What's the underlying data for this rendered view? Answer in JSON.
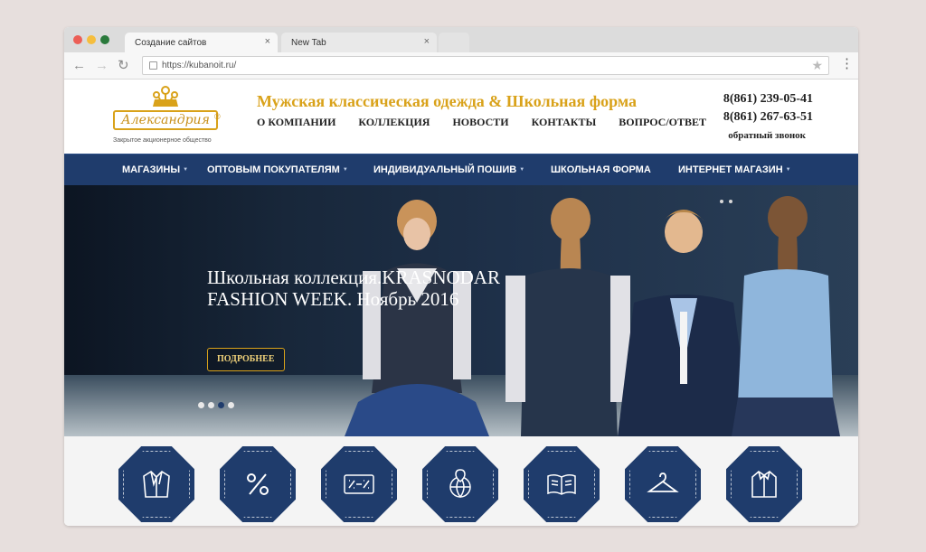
{
  "browser": {
    "tabs": [
      {
        "label": "Создание сайтов",
        "close": "×"
      },
      {
        "label": "New Tab",
        "close": "×"
      }
    ],
    "url": "https://kubanoit.ru/",
    "icons": [
      "back-arrow-icon",
      "forward-arrow-icon",
      "reload-icon",
      "lock-icon",
      "star-icon",
      "menu-dots-icon"
    ]
  },
  "header": {
    "logo_name": "Александрия",
    "logo_reg": "®",
    "logo_subtitle": "Закрытое акционерное общество",
    "slogan": "Мужская классическая одежда & Школьная форма",
    "top_nav": [
      "О КОМПАНИИ",
      "КОЛЛЕКЦИЯ",
      "НОВОСТИ",
      "КОНТАКТЫ",
      "ВОПРОС/ОТВЕТ"
    ],
    "phone1": "8(861) 239-05-41",
    "phone2": "8(861) 267-63-51",
    "callback": "обратный звонок"
  },
  "main_nav": [
    {
      "label": "МАГАЗИНЫ",
      "caret": "▼"
    },
    {
      "label": "ОПТОВЫМ ПОКУПАТЕЛЯМ",
      "caret": "▼"
    },
    {
      "label": "ИНДИВИДУАЛЬНЫЙ ПОШИВ",
      "caret": "▼"
    },
    {
      "label": "ШКОЛЬНАЯ ФОРМА",
      "caret": ""
    },
    {
      "label": "ИНТЕРНЕТ МАГАЗИН",
      "caret": "▼"
    }
  ],
  "hero": {
    "title": "Школьная коллекция.KRASNODAR FASHION WEEK. Ноябрь 2016",
    "button": "ПОДРОБНЕЕ",
    "slides_count": 4,
    "active_slide": 3
  },
  "features": [
    "jacket-icon",
    "percent-icon",
    "discount-card-icon",
    "globe-pin-icon",
    "catalog-book-icon",
    "hanger-icon",
    "shirt-icon"
  ],
  "colors": {
    "brand_gold": "#d9a21a",
    "nav_blue": "#1f3c6c",
    "background": "#e7dfdd"
  }
}
